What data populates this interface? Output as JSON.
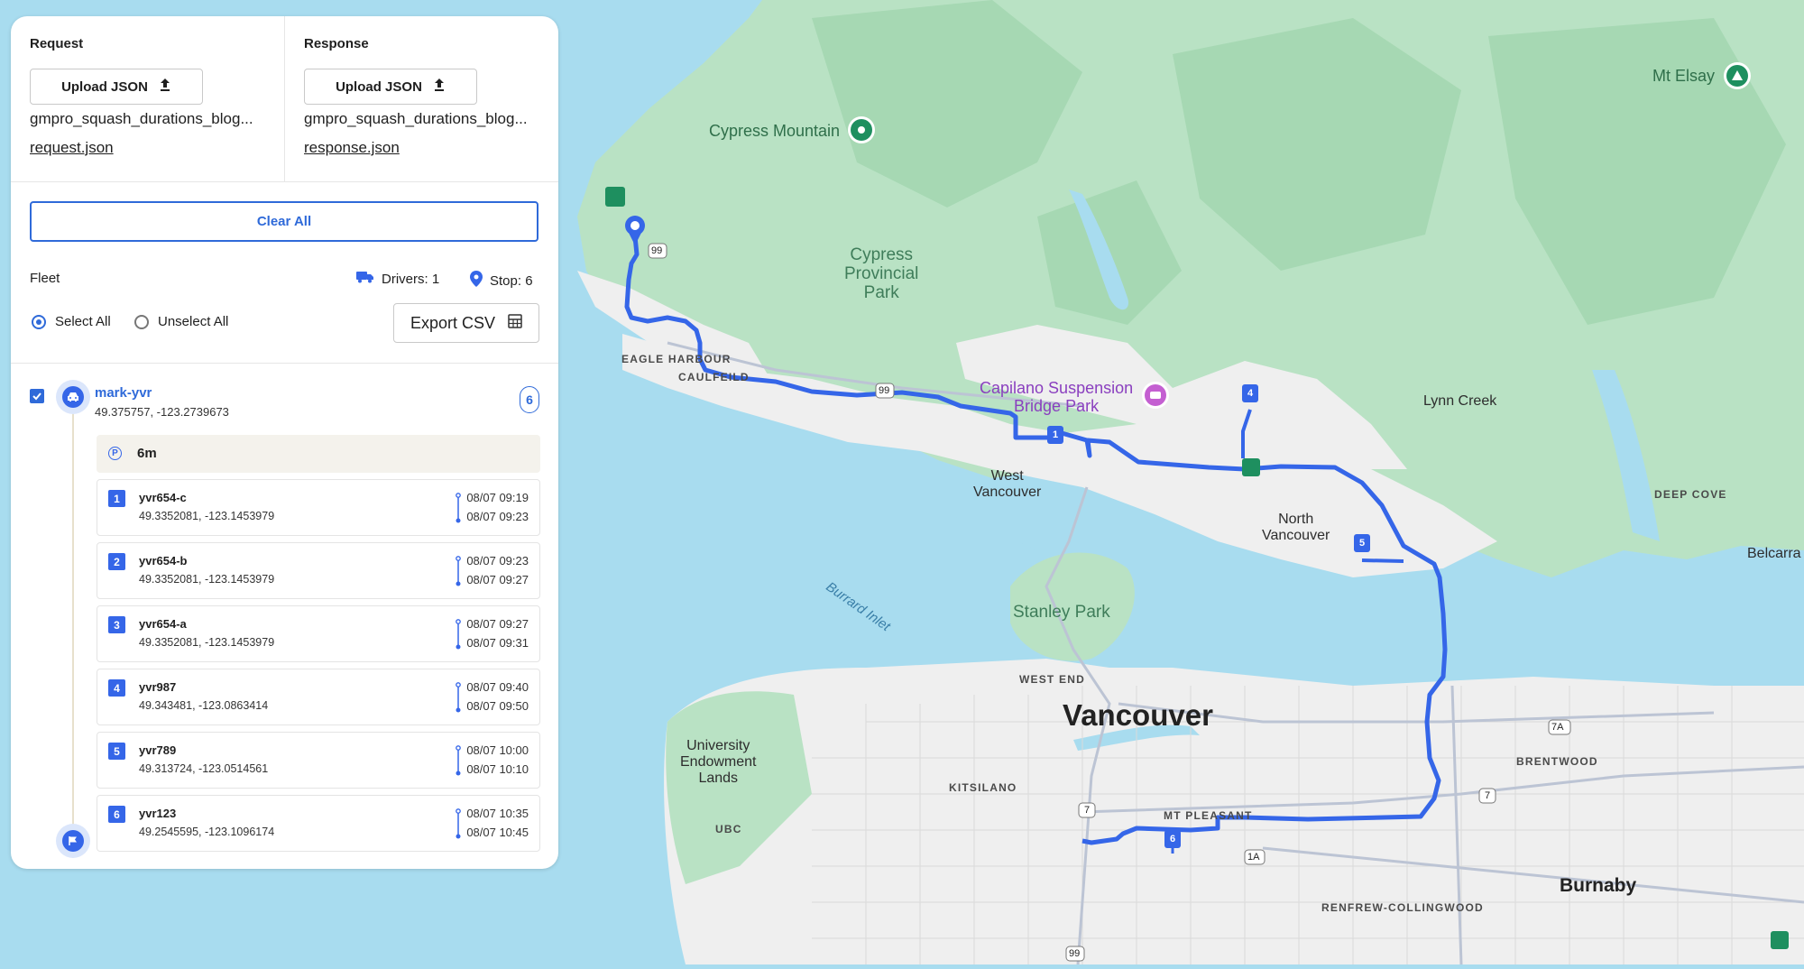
{
  "request": {
    "title": "Request",
    "upload_label": "Upload JSON",
    "filename": "gmpro_squash_durations_blog...",
    "link": "request.json"
  },
  "response": {
    "title": "Response",
    "upload_label": "Upload JSON",
    "filename": "gmpro_squash_durations_blog...",
    "link": "response.json"
  },
  "clear_all_label": "Clear All",
  "fleet": {
    "label": "Fleet",
    "drivers": "Drivers: 1",
    "stops": "Stop: 6",
    "select_all": "Select All",
    "unselect_all": "Unselect All",
    "export_label": "Export CSV"
  },
  "vehicle": {
    "name": "mark-yvr",
    "coords": "49.375757, -123.2739673",
    "stop_count": "6",
    "break_duration": "6m"
  },
  "stops": [
    {
      "num": "1",
      "id": "yvr654-c",
      "coords": "49.3352081, -123.1453979",
      "start": "08/07 09:19",
      "end": "08/07 09:23"
    },
    {
      "num": "2",
      "id": "yvr654-b",
      "coords": "49.3352081, -123.1453979",
      "start": "08/07 09:23",
      "end": "08/07 09:27"
    },
    {
      "num": "3",
      "id": "yvr654-a",
      "coords": "49.3352081, -123.1453979",
      "start": "08/07 09:27",
      "end": "08/07 09:31"
    },
    {
      "num": "4",
      "id": "yvr987",
      "coords": "49.343481, -123.0863414",
      "start": "08/07 09:40",
      "end": "08/07 09:50"
    },
    {
      "num": "5",
      "id": "yvr789",
      "coords": "49.313724, -123.0514561",
      "start": "08/07 10:00",
      "end": "08/07 10:10"
    },
    {
      "num": "6",
      "id": "yvr123",
      "coords": "49.2545595, -123.1096174",
      "start": "08/07 10:35",
      "end": "08/07 10:45"
    }
  ],
  "map_labels": {
    "mt_elsay": "Mt Elsay",
    "cypress_mountain": "Cypress Mountain",
    "cypress_park": "Cypress\nProvincial\nPark",
    "eagle_harbour": "EAGLE HARBOUR",
    "caulfeild": "CAULFEILD",
    "capilano": "Capilano Suspension\nBridge Park",
    "lynn_creek": "Lynn Creek",
    "west_vancouver": "West\nVancouver",
    "north_vancouver": "North\nVancouver",
    "deep_cove": "DEEP COVE",
    "belcarra": "Belcarra",
    "burrard_inlet": "Burrard Inlet",
    "stanley_park": "Stanley Park",
    "west_end": "WEST END",
    "vancouver": "Vancouver",
    "university": "University\nEndowment\nLands",
    "kitsilano": "KITSILANO",
    "mt_pleasant": "MT PLEASANT",
    "brentwood": "BRENTWOOD",
    "ubc": "UBC",
    "burnaby": "Burnaby",
    "renfrew": "RENFREW-COLLINGWOOD",
    "hwy_99": "99",
    "hwy_7a": "7A",
    "hwy_7": "7",
    "hwy_1a": "1A"
  },
  "colors": {
    "route": "#3566e8",
    "water": "#a8dcef",
    "forest": "#b9e2c4",
    "urban": "#efefef",
    "accent": "#2f6ad9"
  }
}
